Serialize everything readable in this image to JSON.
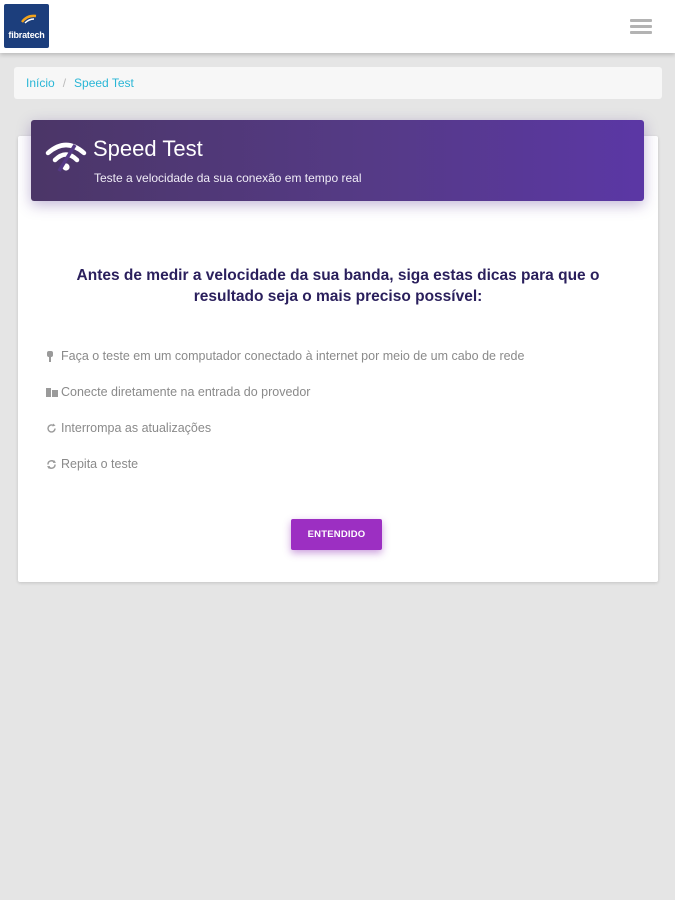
{
  "header": {
    "logo_text": "fibratech",
    "menu_icon": "hamburger-menu-icon"
  },
  "breadcrumb": {
    "home": "Início",
    "separator": "/",
    "current": "Speed Test"
  },
  "card": {
    "title": "Speed Test",
    "subtitle": "Teste a velocidade da sua conexão em tempo real",
    "icon": "wifi-icon",
    "intro": "Antes de medir a velocidade da sua banda, siga estas dicas para que o resultado seja o mais preciso possível:",
    "tips": [
      {
        "icon": "plug-icon",
        "text": "Faça o teste em um computador conectado à internet por meio de um cabo de rede"
      },
      {
        "icon": "building-icon",
        "text": "Conecte diretamente na entrada do provedor"
      },
      {
        "icon": "refresh-icon",
        "text": "Interrompa as atualizações"
      },
      {
        "icon": "repeat-icon",
        "text": "Repita o teste"
      }
    ],
    "button_label": "ENTENDIDO"
  },
  "colors": {
    "header_gradient_start": "#4b3667",
    "header_gradient_end": "#5b37a5",
    "button": "#9c2fc2",
    "intro_text": "#2a1f5c",
    "link": "#29b6d6"
  }
}
